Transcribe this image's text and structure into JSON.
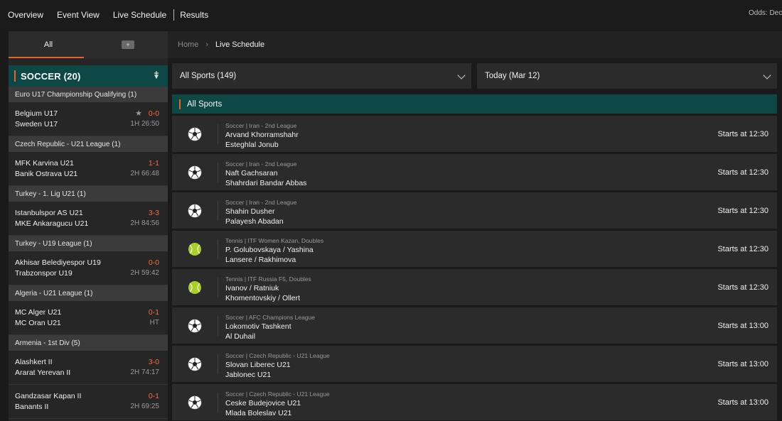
{
  "nav": {
    "items": [
      "Overview",
      "Event View",
      "Live Schedule",
      "Results"
    ],
    "odds_label": "Odds: Dec"
  },
  "sidebar": {
    "tabs": [
      "All",
      "+"
    ],
    "sport_title": "SOCCER (20)",
    "pin_icon": "pin-icon",
    "leagues": [
      {
        "name": "Euro U17 Championship Qualifying (1)",
        "matches": [
          {
            "home": "Belgium U17",
            "away": "Sweden U17",
            "score": "0-0",
            "time": "1H 26:50",
            "starred": true
          }
        ]
      },
      {
        "name": "Czech Republic - U21 League (1)",
        "matches": [
          {
            "home": "MFK Karvina U21",
            "away": "Banik Ostrava U21",
            "score": "1-1",
            "time": "2H 66:48",
            "starred": false
          }
        ]
      },
      {
        "name": "Turkey - 1. Lig U21 (1)",
        "matches": [
          {
            "home": "Istanbulspor AS U21",
            "away": "MKE Ankaragucu U21",
            "score": "3-3",
            "time": "2H 84:56",
            "starred": false
          }
        ]
      },
      {
        "name": "Turkey - U19 League (1)",
        "matches": [
          {
            "home": "Akhisar Belediyespor U19",
            "away": "Trabzonspor U19",
            "score": "0-0",
            "time": "2H 59:42",
            "starred": false
          }
        ]
      },
      {
        "name": "Algeria - U21 League (1)",
        "matches": [
          {
            "home": "MC Alger U21",
            "away": "MC Oran U21",
            "score": "0-1",
            "time": "HT",
            "starred": false
          }
        ]
      },
      {
        "name": "Armenia - 1st Div (5)",
        "matches": [
          {
            "home": "Alashkert II",
            "away": "Ararat Yerevan II",
            "score": "3-0",
            "time": "2H 74:17",
            "starred": false
          },
          {
            "home": "Gandzasar Kapan II",
            "away": "Banants II",
            "score": "0-1",
            "time": "2H 69:25",
            "starred": false
          }
        ]
      }
    ]
  },
  "breadcrumb": {
    "home": "Home",
    "current": "Live Schedule"
  },
  "filters": {
    "sports": "All Sports (149)",
    "date": "Today (Mar 12)"
  },
  "section_title": "All Sports",
  "events": [
    {
      "sport": "soccer",
      "competition": "Soccer | Iran - 2nd League",
      "home": "Arvand Khorramshahr",
      "away": "Esteghlal Jonub",
      "start": "Starts at 12:30"
    },
    {
      "sport": "soccer",
      "competition": "Soccer | Iran - 2nd League",
      "home": "Naft Gachsaran",
      "away": "Shahrdari Bandar Abbas",
      "start": "Starts at 12:30"
    },
    {
      "sport": "soccer",
      "competition": "Soccer | Iran - 2nd League",
      "home": "Shahin Dusher",
      "away": "Palayesh Abadan",
      "start": "Starts at 12:30"
    },
    {
      "sport": "tennis",
      "competition": "Tennis | ITF Women Kazan, Doubles",
      "home": "P. Golubovskaya / Yashina",
      "away": "Lansere / Rakhimova",
      "start": "Starts at 12:30"
    },
    {
      "sport": "tennis",
      "competition": "Tennis | ITF Russia F5, Doubles",
      "home": "Ivanov / Ratniuk",
      "away": "Khomentovskiy / Ollert",
      "start": "Starts at 12:30"
    },
    {
      "sport": "soccer",
      "competition": "Soccer | AFC Champions League",
      "home": "Lokomotiv Tashkent",
      "away": "Al Duhail",
      "start": "Starts at 13:00"
    },
    {
      "sport": "soccer",
      "competition": "Soccer | Czech Republic - U21 League",
      "home": "Slovan Liberec U21",
      "away": "Jablonec U21",
      "start": "Starts at 13:00"
    },
    {
      "sport": "soccer",
      "competition": "Soccer | Czech Republic - U21 League",
      "home": "Ceske Budejovice U21",
      "away": "Mlada Boleslav U21",
      "start": "Starts at 13:00"
    }
  ],
  "colors": {
    "accent": "#e8622b",
    "score": "#ff6a39",
    "teal": "#0d4746"
  }
}
